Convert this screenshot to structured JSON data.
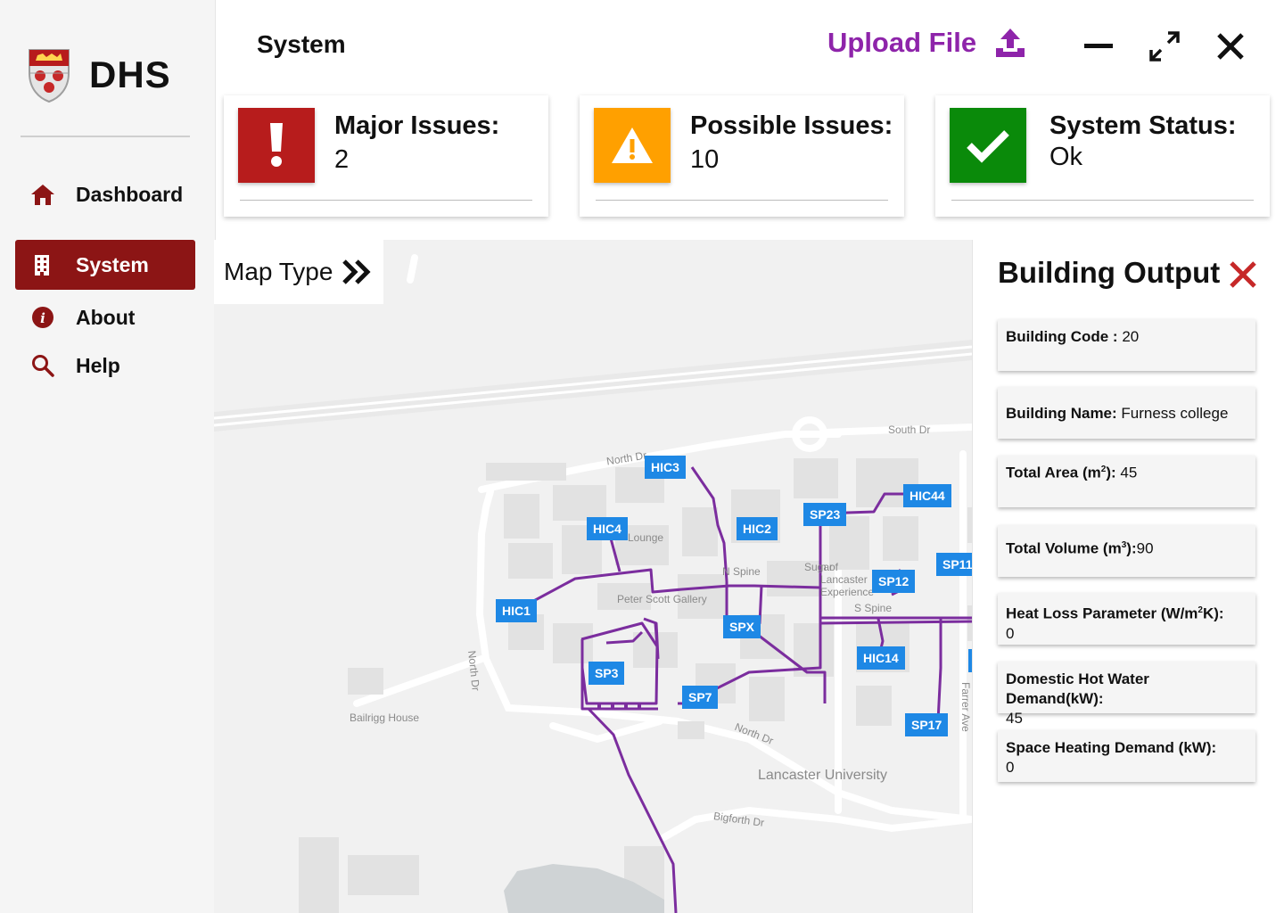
{
  "brand": {
    "name": "DHS",
    "crest_icon": "university-crest-icon"
  },
  "sidebar": {
    "items": [
      {
        "label": "Dashboard",
        "icon": "home-icon",
        "active": false
      },
      {
        "label": "System",
        "icon": "building-icon",
        "active": true
      },
      {
        "label": "About",
        "icon": "info-icon",
        "active": false
      },
      {
        "label": "Help",
        "icon": "search-icon",
        "active": false
      }
    ]
  },
  "header": {
    "title": "System",
    "upload_label": "Upload File",
    "upload_icon": "upload-icon",
    "window_controls": [
      "minimize-icon",
      "expand-icon",
      "close-icon"
    ]
  },
  "status_cards": [
    {
      "title": "Major Issues:",
      "value": "2",
      "color": "#b71c1c",
      "icon": "exclamation-icon"
    },
    {
      "title": "Possible Issues:",
      "value": "10",
      "color": "#ffa000",
      "icon": "warning-icon"
    },
    {
      "title": "System Status:",
      "value": "Ok",
      "color": "#0a8a0a",
      "icon": "checkmark-icon"
    }
  ],
  "map": {
    "map_type_label": "Map Type",
    "map_type_icon": "double-chevron-right-icon",
    "line_color": "#7b2d9e",
    "node_color": "#1e88e5",
    "nodes": [
      "HIC3",
      "HIC44",
      "HIC4",
      "HIC2",
      "SP23",
      "SP11",
      "SP12",
      "HIC1",
      "SPX",
      "HIC14",
      "SP3",
      "SP7",
      "SP17"
    ],
    "places": {
      "north_dr_top": "North Dr",
      "south_dr": "South Dr",
      "lounge": "Lounge",
      "n_spine": "N Spine",
      "sugar": "Sugar",
      "lancaster_exp": "n of Lancaster Experience",
      "peter_scott": "Peter Scott Gallery",
      "s_spine": "S Spine",
      "north_dr_vertical": "North Dr",
      "bailrigg": "Bailrigg House",
      "north_dr_bottom": "North Dr",
      "farrer": "Farrer Ave",
      "lancaster_uni": "Lancaster University",
      "bigforth": "Bigforth Dr"
    }
  },
  "building_output": {
    "title": "Building Output",
    "fields": [
      {
        "key": "Building Code : ",
        "value": "20"
      },
      {
        "key": "Building Name:",
        "value": " Furness college"
      },
      {
        "key": "Total Area (m",
        "sup": "2",
        "key_end": "): ",
        "value": "45"
      },
      {
        "key": "Total Volume (m",
        "sup": "3",
        "key_end": "):",
        "value": "90"
      },
      {
        "key": "Heat Loss Parameter (W/m",
        "sup": "2",
        "key_end": "K):",
        "value": "0"
      },
      {
        "key": "Domestic Hot Water Demand(kW):",
        "value": "45"
      },
      {
        "key": "Space Heating Demand (kW):",
        "value": "0"
      }
    ]
  }
}
